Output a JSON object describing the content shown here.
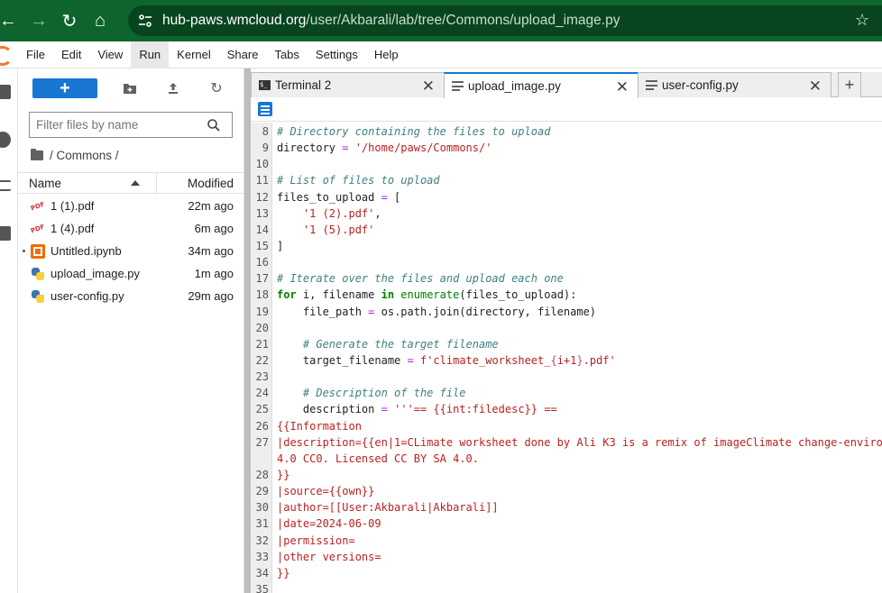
{
  "browser": {
    "url_domain": "hub-paws.wmcloud.org",
    "url_path": "/user/Akbarali/lab/tree/Commons/upload_image.py"
  },
  "menu": [
    "File",
    "Edit",
    "View",
    "Run",
    "Kernel",
    "Share",
    "Tabs",
    "Settings",
    "Help"
  ],
  "menu_active": "Run",
  "filebrowser": {
    "new_label": "+",
    "filter_placeholder": "Filter files by name",
    "breadcrumb": "/ Commons /",
    "col_name": "Name",
    "col_modified": "Modified",
    "files": [
      {
        "name": "1 (1).pdf",
        "modified": "22m ago",
        "type": "pdf"
      },
      {
        "name": "1 (4).pdf",
        "modified": "6m ago",
        "type": "pdf"
      },
      {
        "name": "Untitled.ipynb",
        "modified": "34m ago",
        "type": "notebook"
      },
      {
        "name": "upload_image.py",
        "modified": "1m ago",
        "type": "python"
      },
      {
        "name": "user-config.py",
        "modified": "29m ago",
        "type": "python"
      }
    ]
  },
  "tabs": [
    {
      "label": "Terminal 2",
      "icon": "terminal-icon"
    },
    {
      "label": "upload_image.py",
      "icon": "text-file-icon",
      "active": true
    },
    {
      "label": "user-config.py",
      "icon": "text-file-icon"
    }
  ],
  "code_lines": [
    {
      "n": "8",
      "text": "# Directory containing the files to upload"
    },
    {
      "n": "9",
      "text": "directory = '/home/paws/Commons/'"
    },
    {
      "n": "10",
      "text": ""
    },
    {
      "n": "11",
      "text": "# List of files to upload"
    },
    {
      "n": "12",
      "text": "files_to_upload = ["
    },
    {
      "n": "13",
      "text": "    '1 (2).pdf',"
    },
    {
      "n": "14",
      "text": "    '1 (5).pdf'"
    },
    {
      "n": "15",
      "text": "]"
    },
    {
      "n": "16",
      "text": ""
    },
    {
      "n": "17",
      "text": "# Iterate over the files and upload each one"
    },
    {
      "n": "18",
      "text": "for i, filename in enumerate(files_to_upload):"
    },
    {
      "n": "19",
      "text": "    file_path = os.path.join(directory, filename)"
    },
    {
      "n": "20",
      "text": ""
    },
    {
      "n": "21",
      "text": "    # Generate the target filename"
    },
    {
      "n": "22",
      "text": "    target_filename = f'climate_worksheet_{i+1}.pdf'"
    },
    {
      "n": "23",
      "text": ""
    },
    {
      "n": "24",
      "text": "    # Description of the file"
    },
    {
      "n": "25",
      "text": "    description = '''== {{int:filedesc}} =="
    },
    {
      "n": "26",
      "text": "{{Information"
    },
    {
      "n": "27",
      "text": "|description={{en|1=CLimate worksheet done by Ali K3 is a remix of imageClimate change-environ"
    },
    {
      "n": "",
      "text": "4.0 CC0. Licensed CC BY SA 4.0."
    },
    {
      "n": "28",
      "text": "}}"
    },
    {
      "n": "29",
      "text": "|source={{own}}"
    },
    {
      "n": "30",
      "text": "|author=[[User:Akbarali|Akbarali]]"
    },
    {
      "n": "31",
      "text": "|date=2024-06-09"
    },
    {
      "n": "32",
      "text": "|permission="
    },
    {
      "n": "33",
      "text": "|other versions="
    },
    {
      "n": "34",
      "text": "}}"
    },
    {
      "n": "35",
      "text": ""
    }
  ]
}
